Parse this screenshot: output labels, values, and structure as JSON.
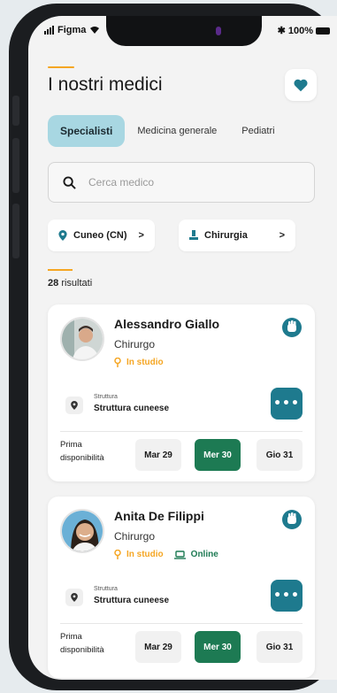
{
  "status_bar": {
    "carrier": "Figma",
    "battery": "100%"
  },
  "page": {
    "title": "I nostri medici"
  },
  "tabs": [
    {
      "label": "Specialisti",
      "active": true
    },
    {
      "label": "Medicina generale",
      "active": false
    },
    {
      "label": "Pediatri",
      "active": false
    }
  ],
  "search": {
    "placeholder": "Cerca medico",
    "value": ""
  },
  "filters": {
    "location": "Cuneo (CN)",
    "specialty": "Chirurgia"
  },
  "results": {
    "count": "28",
    "label": "risultati"
  },
  "doctors": [
    {
      "name": "Alessandro Giallo",
      "specialty": "Chirurgo",
      "mode_studio": "In studio",
      "mode_online": "",
      "structure_label": "Struttura",
      "structure_name": "Struttura cuneese",
      "availability_label_1": "Prima",
      "availability_label_2": "disponibilità",
      "slots": [
        "Mar 29",
        "Mer 30",
        "Gio 31"
      ],
      "selected_slot": "Mer 30"
    },
    {
      "name": "Anita De Filippi",
      "specialty": "Chirurgo",
      "mode_studio": "In studio",
      "mode_online": "Online",
      "structure_label": "Struttura",
      "structure_name": "Struttura cuneese",
      "availability_label_1": "Prima",
      "availability_label_2": "disponibilità",
      "slots": [
        "Mar 29",
        "Mer 30",
        "Gio 31"
      ],
      "selected_slot": "Mer 30"
    }
  ],
  "colors": {
    "accent_orange": "#f5a623",
    "tab_active": "#a8d7e2",
    "teal_button": "#1e7a8e",
    "green_selected": "#1d7a53"
  },
  "icons": [
    "heart-icon",
    "search-icon",
    "location-pin-icon",
    "surgery-icon",
    "chevron-right-icon",
    "hand-icon",
    "laptop-icon",
    "more-icon"
  ]
}
